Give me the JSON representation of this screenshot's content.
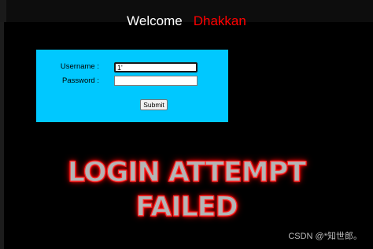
{
  "header": {
    "welcome_text": "Welcome",
    "user_name": "Dhakkan"
  },
  "login_form": {
    "username_label": "Username :",
    "username_value": "1'",
    "password_label": "Password :",
    "password_value": "",
    "submit_label": "Submit"
  },
  "banner": {
    "line1": "LOGIN ATTEMPT",
    "line2": "FAILED"
  },
  "watermark": {
    "text": "CSDN @*知世郎。"
  },
  "colors": {
    "background": "#000000",
    "form_background": "#00c8ff",
    "user_name": "#ff0000",
    "banner_glow": "#ff0000"
  }
}
